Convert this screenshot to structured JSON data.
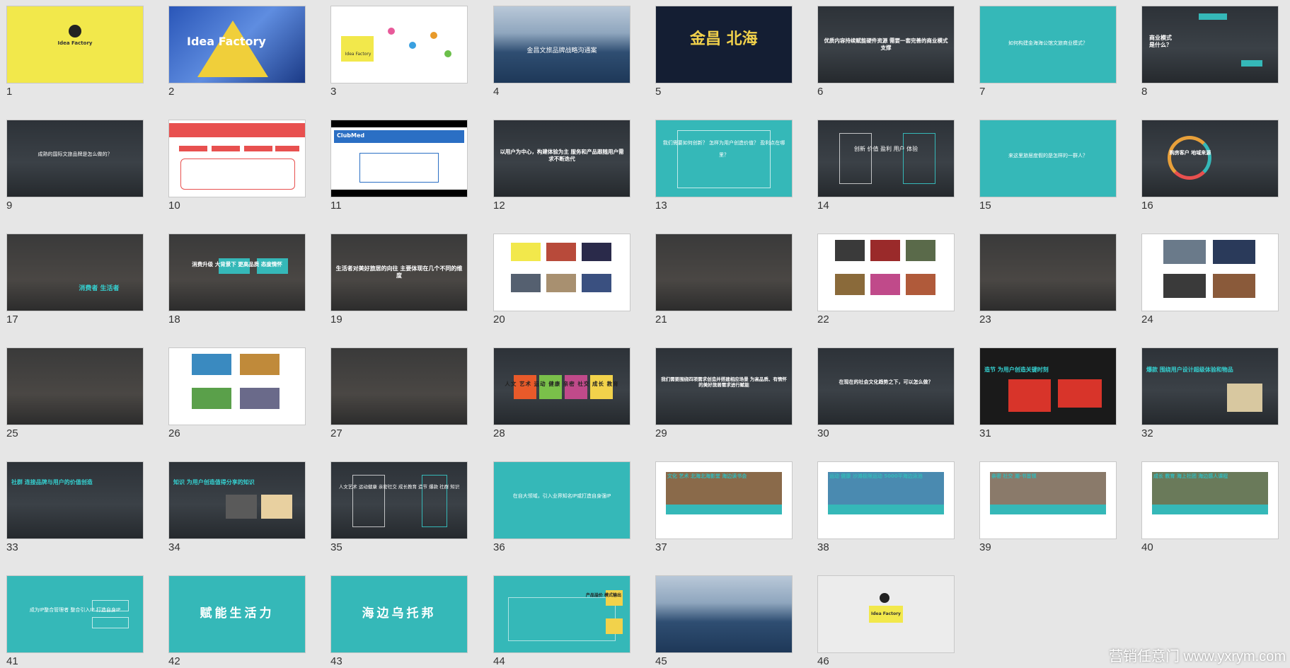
{
  "watermark": "营销任意门 www.yxrym.com",
  "slides": [
    {
      "n": "1",
      "text": "Idea Factory"
    },
    {
      "n": "2",
      "text": "Idea Factory"
    },
    {
      "n": "3",
      "text": "Idea Factory"
    },
    {
      "n": "4",
      "text": "金昌文旅品牌战略沟通案"
    },
    {
      "n": "5",
      "text": "金昌 北海"
    },
    {
      "n": "6",
      "text": "优质内容持续赋能硬件资源 需要一套完善的商业模式支撑"
    },
    {
      "n": "7",
      "text": "如何构建金海海公馆文旅商业模式？"
    },
    {
      "n": "8",
      "text": "商业模式 是什么？"
    },
    {
      "n": "9",
      "text": "成熟的国际文旅品牌是怎么做的？"
    },
    {
      "n": "10",
      "text": ""
    },
    {
      "n": "11",
      "text": "ClubMed"
    },
    {
      "n": "12",
      "text": "以用户为中心，构建体验为主 服务和产品跟随用户需求不断迭代"
    },
    {
      "n": "13",
      "text": "我们需要如何创新？ 怎样为用户创造价值？ 盈利点在哪里？"
    },
    {
      "n": "14",
      "text": "创新 价值 盈利 用户 体验"
    },
    {
      "n": "15",
      "text": "来这里旅居度假的是怎样的一群人？"
    },
    {
      "n": "16",
      "text": "购房客户 地域来源"
    },
    {
      "n": "17",
      "text": "消费者 生活者"
    },
    {
      "n": "18",
      "text": "消费升级 大背景下 更高品质 态度情怀"
    },
    {
      "n": "19",
      "text": "生活者对美好旅居的向往 主要体现在几个不同的维度"
    },
    {
      "n": "20",
      "text": ""
    },
    {
      "n": "21",
      "text": ""
    },
    {
      "n": "22",
      "text": ""
    },
    {
      "n": "23",
      "text": ""
    },
    {
      "n": "24",
      "text": ""
    },
    {
      "n": "25",
      "text": ""
    },
    {
      "n": "26",
      "text": ""
    },
    {
      "n": "27",
      "text": ""
    },
    {
      "n": "28",
      "text": "人文 艺术 运动 健康 亲密 社交 成长 教育"
    },
    {
      "n": "29",
      "text": "我们需要围绕四项需求创造并搭建相应场景 为高品质、有情怀的美好旅居需求进行赋能"
    },
    {
      "n": "30",
      "text": "在现在的社会文化趋势之下，可以怎么做？"
    },
    {
      "n": "31",
      "text": "造节 为用户创造关键时刻"
    },
    {
      "n": "32",
      "text": "爆款 围绕用户设计超级体验和物品"
    },
    {
      "n": "33",
      "text": "社群 连接品牌与用户的价值创造"
    },
    {
      "n": "34",
      "text": "知识 为用户创造值得分享的知识"
    },
    {
      "n": "35",
      "text": "人文艺术 运动健康 亲密社交 成长教育 造节 爆款 社群 知识"
    },
    {
      "n": "36",
      "text": "在自大领域，引入业界知名IP或打造自身强IP"
    },
    {
      "n": "37",
      "text": "文化 艺术 北海北海影堂 海边读书会"
    },
    {
      "n": "38",
      "text": "运动 健康 沙滩极限运动 5000平海边泳池"
    },
    {
      "n": "39",
      "text": "亲密 社交 潮·书首领"
    },
    {
      "n": "40",
      "text": "成长 教育 海上社团 海边感人课程"
    },
    {
      "n": "41",
      "text": "成为IP整合管理者 整合引入IP 打造自身IP"
    },
    {
      "n": "42",
      "text": "赋能生活力"
    },
    {
      "n": "43",
      "text": "海边乌托邦"
    },
    {
      "n": "44",
      "text": "产品溢价 模式输出"
    },
    {
      "n": "45",
      "text": ""
    },
    {
      "n": "46",
      "text": "Idea Factory"
    }
  ]
}
